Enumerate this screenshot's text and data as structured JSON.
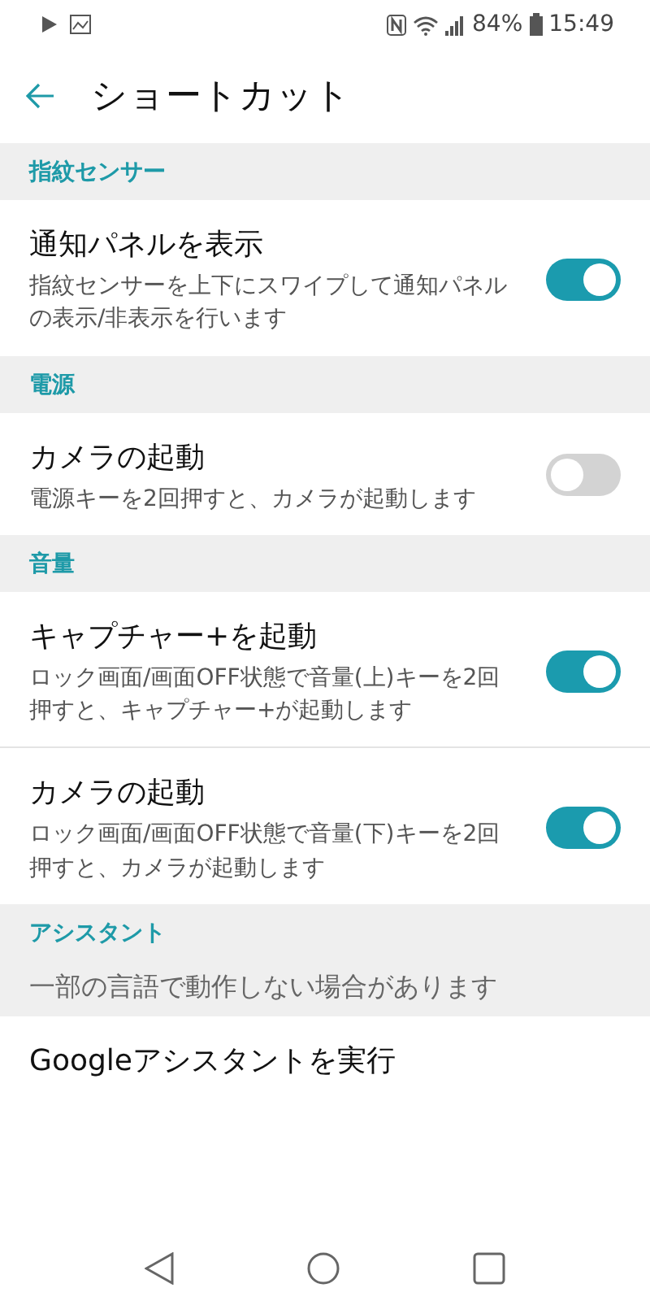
{
  "status_bar": {
    "battery": "84%",
    "time": "15:49"
  },
  "toolbar": {
    "title": "ショートカット"
  },
  "sections": [
    {
      "title": "指紋センサー",
      "items": [
        {
          "kind": "switch",
          "title": "通知パネルを表示",
          "description": "指紋センサーを上下にスワイプして通知パネルの表示/非表示を行います",
          "on": true
        }
      ]
    },
    {
      "title": "電源",
      "items": [
        {
          "kind": "switch",
          "title": "カメラの起動",
          "description": "電源キーを2回押すと、カメラが起動します",
          "on": false
        }
      ]
    },
    {
      "title": "音量",
      "items": [
        {
          "kind": "switch",
          "title": "キャプチャー+を起動",
          "description": "ロック画面/画面OFF状態で音量(上)キーを2回押すと、キャプチャー+が起動します",
          "on": true
        },
        {
          "kind": "switch",
          "title": "カメラの起動",
          "description": "ロック画面/画面OFF状態で音量(下)キーを2回押すと、カメラが起動します",
          "on": true
        }
      ]
    },
    {
      "title": "アシスタント",
      "note": "一部の言語で動作しない場合があります",
      "items": [
        {
          "kind": "plain",
          "title": "Googleアシスタントを実行"
        }
      ]
    }
  ]
}
